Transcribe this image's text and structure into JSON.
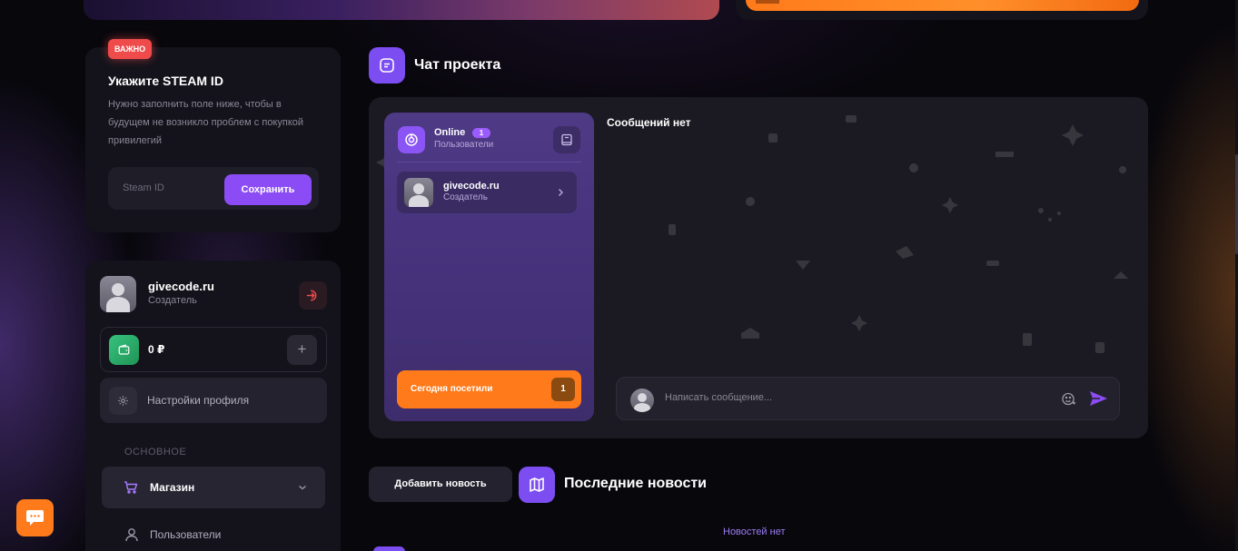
{
  "steam": {
    "badge": "ВАЖНО",
    "title": "Укажите STEAM ID",
    "description": "Нужно заполнить поле ниже, чтобы в будущем не возникло проблем с покупкой привилегий",
    "input_placeholder": "Steam ID",
    "save_label": "Сохранить"
  },
  "profile": {
    "name": "givecode.ru",
    "role": "Создатель",
    "balance": "0 ₽",
    "settings_label": "Настройки профиля"
  },
  "nav": {
    "section_label": "ОСНОВНОЕ",
    "items": [
      {
        "label": "Магазин",
        "icon": "cart-icon"
      },
      {
        "label": "Пользователи",
        "icon": "user-icon"
      }
    ]
  },
  "chat": {
    "title": "Чат проекта",
    "online_label": "Online",
    "online_count": "1",
    "online_sub": "Пользователи",
    "users": [
      {
        "name": "givecode.ru",
        "role": "Создатель"
      }
    ],
    "today_label": "Сегодня посетили",
    "today_count": "1",
    "empty_label": "Сообщений нет",
    "input_placeholder": "Написать сообщение..."
  },
  "news": {
    "add_label": "Добавить новость",
    "title": "Последние новости",
    "empty_label": "Новостей нет"
  },
  "colors": {
    "accent": "#8b4cf5",
    "orange": "#ff7a1a",
    "danger": "#ef4b4b",
    "success": "#2fb36d"
  }
}
